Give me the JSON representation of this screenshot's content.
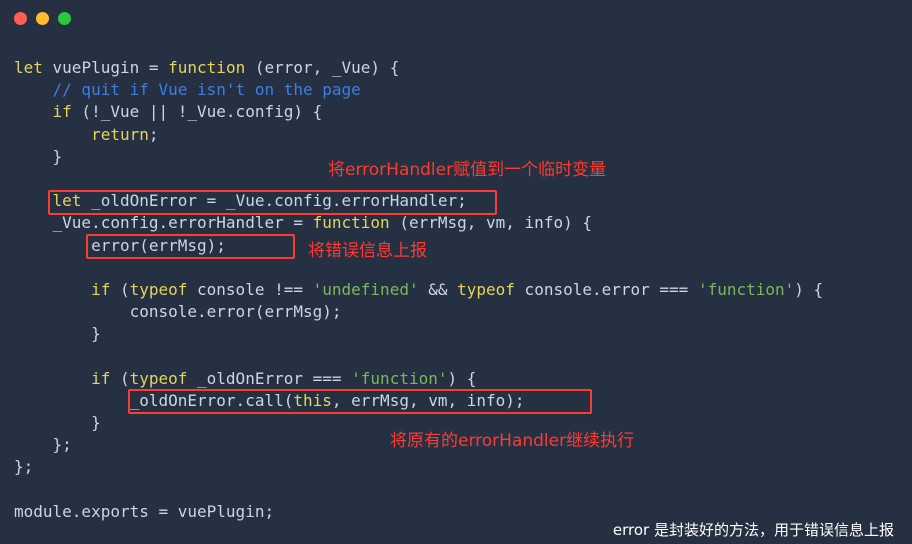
{
  "window": {
    "dots": [
      {
        "name": "close",
        "color": "#ff5f57"
      },
      {
        "name": "minimize",
        "color": "#febc2e"
      },
      {
        "name": "zoom",
        "color": "#28c840"
      }
    ]
  },
  "colors": {
    "default": "#c9d6e6",
    "keyword": "#e6d35a",
    "comment": "#3f7ee0",
    "string": "#7bb859",
    "annotation": "#ff3b30",
    "caption": "#ffffff"
  },
  "code_lines": [
    [
      {
        "t": "let",
        "c": "keyword"
      },
      {
        "t": " vuePlugin = ",
        "c": "default"
      },
      {
        "t": "function",
        "c": "keyword"
      },
      {
        "t": " (error, _Vue) {",
        "c": "default"
      }
    ],
    [
      {
        "t": "    // quit if Vue isn't on the page",
        "c": "comment"
      }
    ],
    [
      {
        "t": "    ",
        "c": "default"
      },
      {
        "t": "if",
        "c": "keyword"
      },
      {
        "t": " (!_Vue || !_Vue.config) {",
        "c": "default"
      }
    ],
    [
      {
        "t": "        ",
        "c": "default"
      },
      {
        "t": "return",
        "c": "keyword"
      },
      {
        "t": ";",
        "c": "default"
      }
    ],
    [
      {
        "t": "    }",
        "c": "default"
      }
    ],
    [],
    [
      {
        "t": "    ",
        "c": "default"
      },
      {
        "t": "let",
        "c": "keyword"
      },
      {
        "t": " _oldOnError = _Vue.config.errorHandler;",
        "c": "default"
      }
    ],
    [
      {
        "t": "    _Vue.config.errorHandler = ",
        "c": "default"
      },
      {
        "t": "function",
        "c": "keyword"
      },
      {
        "t": " (errMsg, vm, info) {",
        "c": "default"
      }
    ],
    [
      {
        "t": "        error(errMsg);",
        "c": "default"
      }
    ],
    [],
    [
      {
        "t": "        ",
        "c": "default"
      },
      {
        "t": "if",
        "c": "keyword"
      },
      {
        "t": " (",
        "c": "default"
      },
      {
        "t": "typeof",
        "c": "keyword"
      },
      {
        "t": " console !== ",
        "c": "default"
      },
      {
        "t": "'undefined'",
        "c": "string"
      },
      {
        "t": " && ",
        "c": "default"
      },
      {
        "t": "typeof",
        "c": "keyword"
      },
      {
        "t": " console.error === ",
        "c": "default"
      },
      {
        "t": "'function'",
        "c": "string"
      },
      {
        "t": ") {",
        "c": "default"
      }
    ],
    [
      {
        "t": "            console.error(errMsg);",
        "c": "default"
      }
    ],
    [
      {
        "t": "        }",
        "c": "default"
      }
    ],
    [],
    [
      {
        "t": "        ",
        "c": "default"
      },
      {
        "t": "if",
        "c": "keyword"
      },
      {
        "t": " (",
        "c": "default"
      },
      {
        "t": "typeof",
        "c": "keyword"
      },
      {
        "t": " _oldOnError === ",
        "c": "default"
      },
      {
        "t": "'function'",
        "c": "string"
      },
      {
        "t": ") {",
        "c": "default"
      }
    ],
    [
      {
        "t": "            _oldOnError.call(",
        "c": "default"
      },
      {
        "t": "this",
        "c": "keyword"
      },
      {
        "t": ", errMsg, vm, info);",
        "c": "default"
      }
    ],
    [
      {
        "t": "        }",
        "c": "default"
      }
    ],
    [
      {
        "t": "    };",
        "c": "default"
      }
    ],
    [
      {
        "t": "};",
        "c": "default"
      }
    ],
    [],
    [
      {
        "t": "module.exports = vuePlugin;",
        "c": "default"
      }
    ]
  ],
  "annotations": {
    "assign_note": "将errorHandler赋值到一个临时变量",
    "report_note": "将错误信息上报",
    "continue_note": "将原有的errorHandler继续执行"
  },
  "caption": "error 是封装好的方法，用于错误信息上报"
}
